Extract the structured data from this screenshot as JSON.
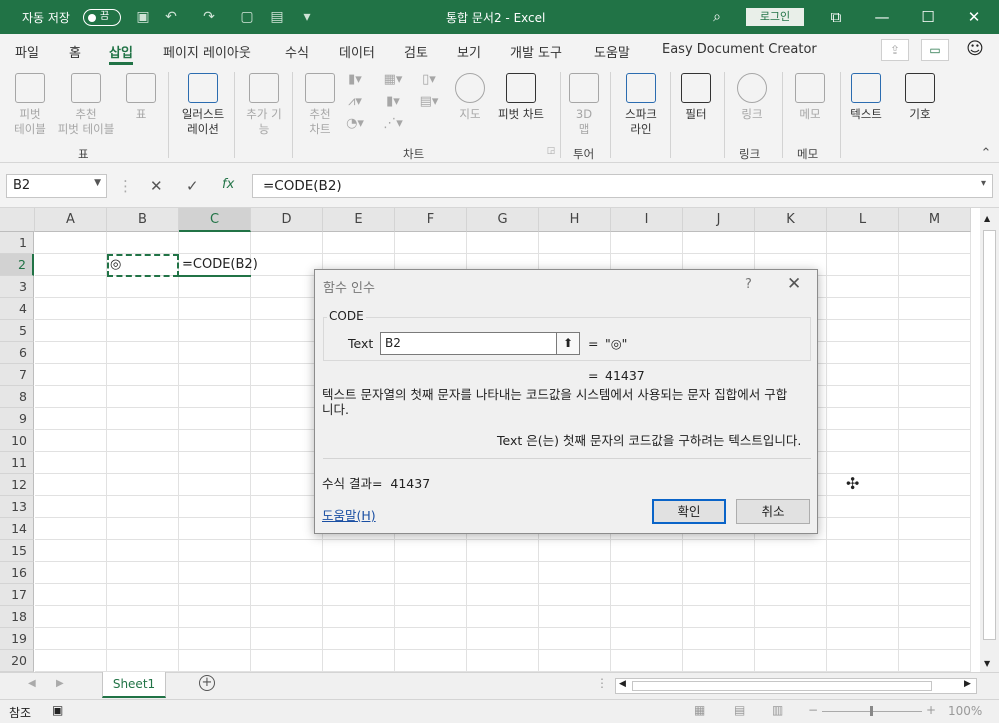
{
  "titlebar": {
    "autosave_label": "자동 저장",
    "autosave_state": "끔",
    "document_title": "통합 문서2  -  Excel",
    "login_label": "로그인"
  },
  "menu": {
    "items": [
      "파일",
      "홈",
      "삽입",
      "페이지 레이아웃",
      "수식",
      "데이터",
      "검토",
      "보기",
      "개발 도구",
      "도움말",
      "Easy Document Creator"
    ],
    "active": "삽입"
  },
  "ribbon": {
    "pivot_table": "피벗\n테이블",
    "recommended_pivot": "추천\n피벗 테이블",
    "table": "표",
    "illustrations": "일러스트\n레이션",
    "addins": "추가 기\n능",
    "recommended_charts": "추천\n차트",
    "maps": "지도",
    "pivot_chart": "피벗 차트",
    "map3d": "3D\n맵",
    "sparklines": "스파크\n라인",
    "filter": "필터",
    "link": "링크",
    "comment": "메모",
    "text": "텍스트",
    "symbol": "기호",
    "group_table": "표",
    "group_charts": "차트",
    "group_tours": "투어",
    "group_links": "링크",
    "group_comments": "메모"
  },
  "formula_bar": {
    "name_box": "B2",
    "fx_label": "fx",
    "formula": "=CODE(B2)"
  },
  "grid": {
    "columns": [
      "A",
      "B",
      "C",
      "D",
      "E",
      "F",
      "G",
      "H",
      "I",
      "J",
      "K",
      "L",
      "M"
    ],
    "rows": [
      "1",
      "2",
      "3",
      "4",
      "5",
      "6",
      "7",
      "8",
      "9",
      "10",
      "11",
      "12",
      "13",
      "14",
      "15",
      "16",
      "17",
      "18",
      "19",
      "20"
    ],
    "selected_column": "C",
    "selected_row": "2",
    "cell_B2": "◎",
    "cell_C2": "=CODE(B2)"
  },
  "dialog": {
    "title": "함수 인수",
    "help_glyph": "?",
    "function_name": "CODE",
    "arg_label": "Text",
    "arg_value": "B2",
    "arg_result": "\"◎\"",
    "eq": "=",
    "result_value": "41437",
    "description": "텍스트 문자열의 첫째 문자를 나타내는 코드값을 시스템에서 사용되는 문자 집합에서 구합니다.",
    "arg_description": "Text  은(는) 첫째 문자의 코드값을 구하려는 텍스트입니다.",
    "formula_result_label": "수식 결과=",
    "formula_result_value": "41437",
    "help_link": "도움말(H)",
    "ok_label": "확인",
    "cancel_label": "취소"
  },
  "sheets": {
    "tabs": [
      "Sheet1"
    ]
  },
  "status": {
    "mode": "참조",
    "zoom": "100%"
  }
}
